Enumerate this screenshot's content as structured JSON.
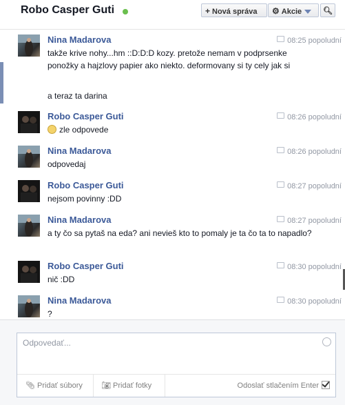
{
  "header": {
    "title": "Robo Casper Guti",
    "new_message_label": "Nová správa",
    "actions_label": "Akcie"
  },
  "messages": [
    {
      "sender": "Nina Madarova",
      "time": "08:25 popoludní",
      "text1": "takže krive nohy...hm  ::D:D:D kozy. pretože nemam v podprsenke ponožky a hajzlovy papier ako niekto. deformovany si ty cely jak si",
      "text2": "a teraz ta darina"
    },
    {
      "sender": "Robo Casper Guti",
      "time": "08:26 popoludní",
      "text1": "zle odpovede"
    },
    {
      "sender": "Nina Madarova",
      "time": "08:26 popoludní",
      "text1": "odpovedaj"
    },
    {
      "sender": "Robo Casper Guti",
      "time": "08:27 popoludní",
      "text1": "nejsom povinny :DD"
    },
    {
      "sender": "Nina Madarova",
      "time": "08:27 popoludní",
      "text1": "a ty čo sa pytaš na eda? ani nevieš kto to pomaly je ta čo ta to napadlo?"
    },
    {
      "sender": "Robo Casper Guti",
      "time": "08:30 popoludní",
      "text1": "nič :DD"
    },
    {
      "sender": "Nina Madarova",
      "time": "08:30 popoludní",
      "text1": "?"
    }
  ],
  "composer": {
    "placeholder": "Odpovedať...",
    "attach_files_label": "Pridať súbory",
    "attach_photos_label": "Pridať fotky",
    "send_on_enter_label": "Odoslať stlačením Enter",
    "send_on_enter_checked": true
  },
  "colors": {
    "accent": "#3b5998",
    "online": "#6bbf4e"
  }
}
